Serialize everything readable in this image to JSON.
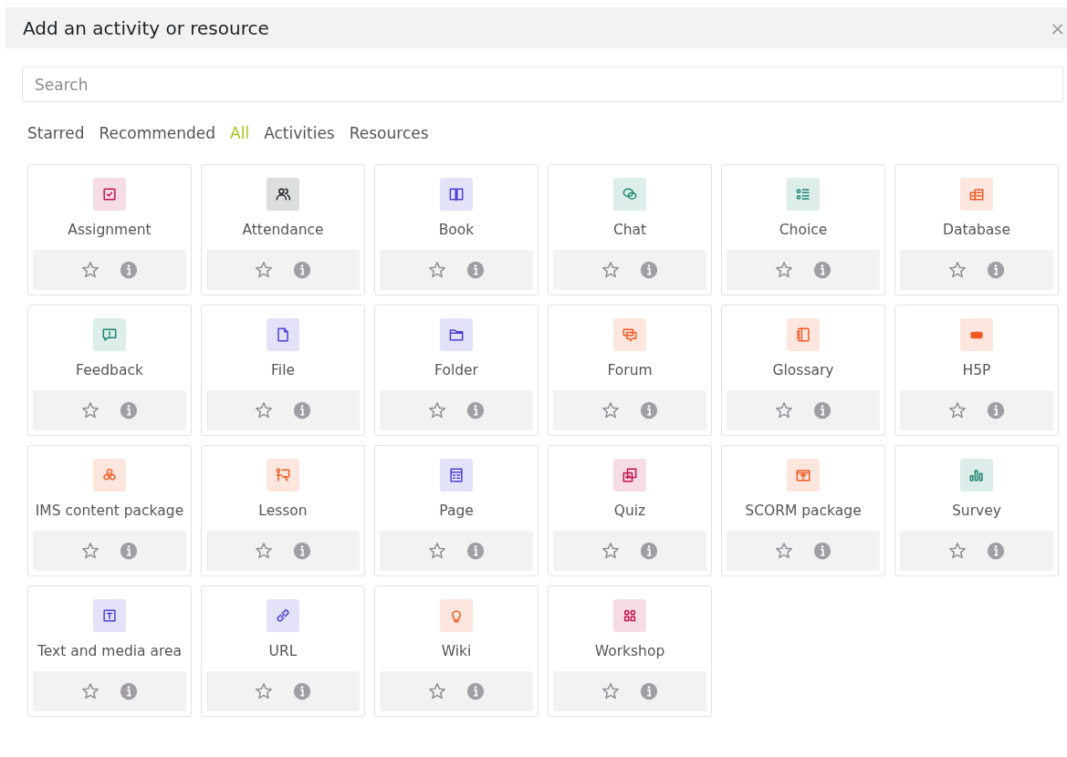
{
  "dialog": {
    "title": "Add an activity or resource",
    "close": "×"
  },
  "search": {
    "placeholder": "Search"
  },
  "tabs": [
    {
      "label": "Starred",
      "selected": false
    },
    {
      "label": "Recommended",
      "selected": false
    },
    {
      "label": "All",
      "selected": true
    },
    {
      "label": "Activities",
      "selected": false
    },
    {
      "label": "Resources",
      "selected": false
    }
  ],
  "modules": [
    {
      "name": "Assignment",
      "color": "#c4134f",
      "starred": false
    },
    {
      "name": "Attendance",
      "color": "#1d2125",
      "starred": false
    },
    {
      "name": "Book",
      "color": "#4c40d4",
      "starred": false
    },
    {
      "name": "Chat",
      "color": "#1d8570",
      "starred": false
    },
    {
      "name": "Choice",
      "color": "#1d8570",
      "starred": false
    },
    {
      "name": "Database",
      "color": "#f15a24",
      "starred": false
    },
    {
      "name": "Feedback",
      "color": "#1d8570",
      "starred": false
    },
    {
      "name": "File",
      "color": "#4c40d4",
      "starred": false
    },
    {
      "name": "Folder",
      "color": "#4c40d4",
      "starred": false
    },
    {
      "name": "Forum",
      "color": "#f15a24",
      "starred": false
    },
    {
      "name": "Glossary",
      "color": "#f15a24",
      "starred": false
    },
    {
      "name": "H5P",
      "color": "#f15a24",
      "starred": false
    },
    {
      "name": "IMS content package",
      "color": "#f15a24",
      "starred": false
    },
    {
      "name": "Lesson",
      "color": "#f15a24",
      "starred": false
    },
    {
      "name": "Page",
      "color": "#4c40d4",
      "starred": false
    },
    {
      "name": "Quiz",
      "color": "#c4134f",
      "starred": false
    },
    {
      "name": "SCORM package",
      "color": "#f15a24",
      "starred": false
    },
    {
      "name": "Survey",
      "color": "#1d8570",
      "starred": false
    },
    {
      "name": "Text and media area",
      "color": "#4c40d4",
      "starred": false
    },
    {
      "name": "URL",
      "color": "#4c40d4",
      "starred": false
    },
    {
      "name": "Wiki",
      "color": "#f15a24",
      "starred": false
    },
    {
      "name": "Workshop",
      "color": "#c4134f",
      "starred": false
    }
  ]
}
